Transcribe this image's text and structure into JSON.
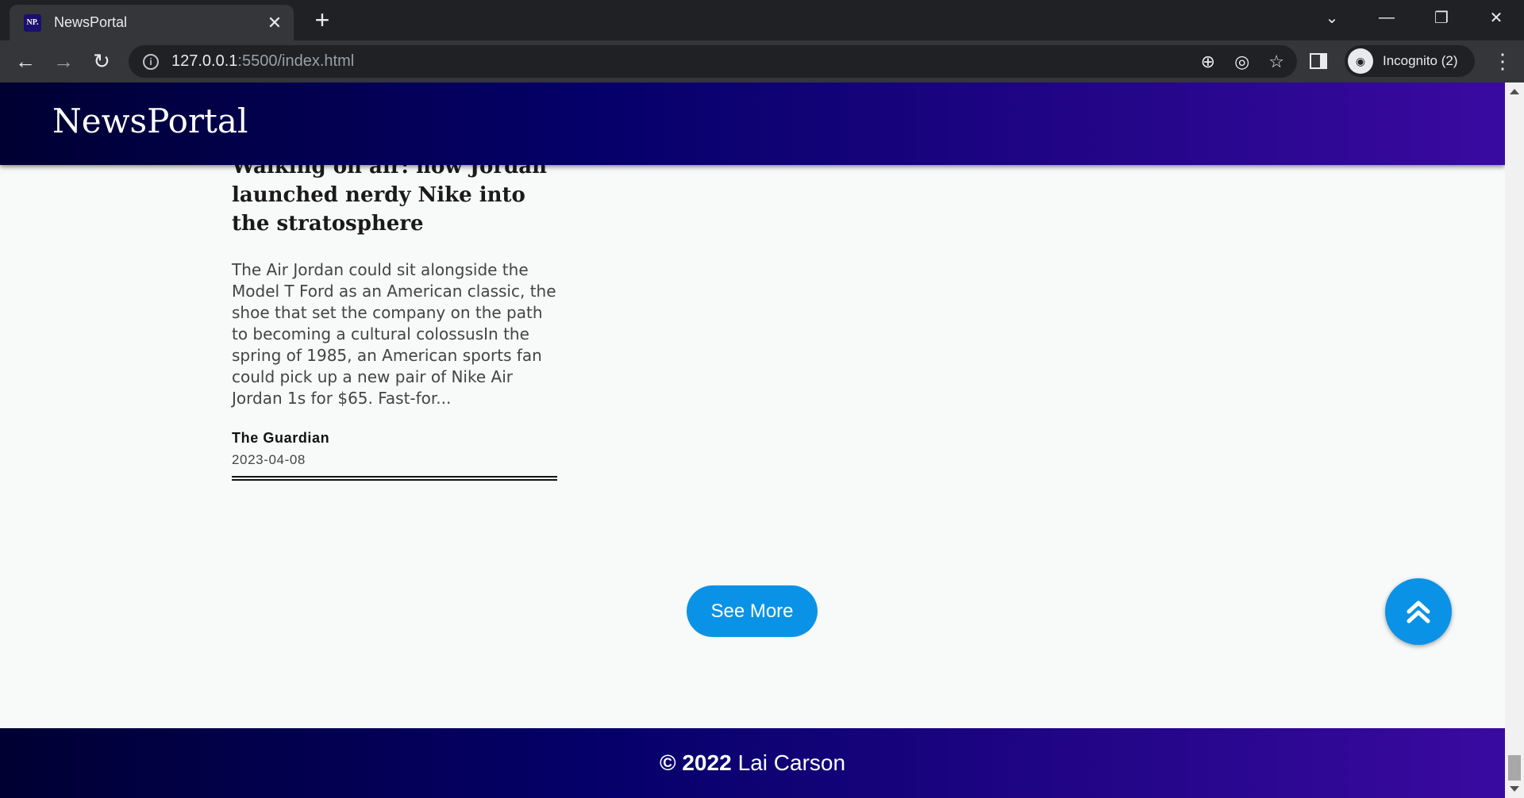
{
  "browser": {
    "tab": {
      "favicon_text": "NP.",
      "title": "NewsPortal",
      "close_icon": "close-icon"
    },
    "new_tab_icon": "plus-icon",
    "window_controls": [
      "chevron-down-icon",
      "minimize-icon",
      "restore-icon",
      "close-icon"
    ],
    "url": {
      "host": "127.0.0.1",
      "rest": ":5500/index.html"
    },
    "omnibox_icons": [
      "zoom-icon",
      "eye-off-icon",
      "star-icon"
    ],
    "profile": {
      "label": "Incognito (2)"
    }
  },
  "site": {
    "logo": "NewsPortal",
    "article": {
      "title": "Walking on air: how Jordan launched nerdy Nike into the stratosphere",
      "description": "The Air Jordan could sit alongside the Model T Ford as an American classic, the shoe that set the company on the path to becoming a cultural colossusIn the spring of 1985, an American sports fan could pick up a new pair of Nike Air Jordan 1s for $65. Fast-for...",
      "source": "The Guardian",
      "date": "2023-04-08"
    },
    "see_more_label": "See More",
    "footer": {
      "year": "© 2022",
      "author": "Lai Carson"
    }
  },
  "colors": {
    "accent": "#0a93e6",
    "header_dark": "#000033",
    "header_purple": "#3a0aa0"
  }
}
